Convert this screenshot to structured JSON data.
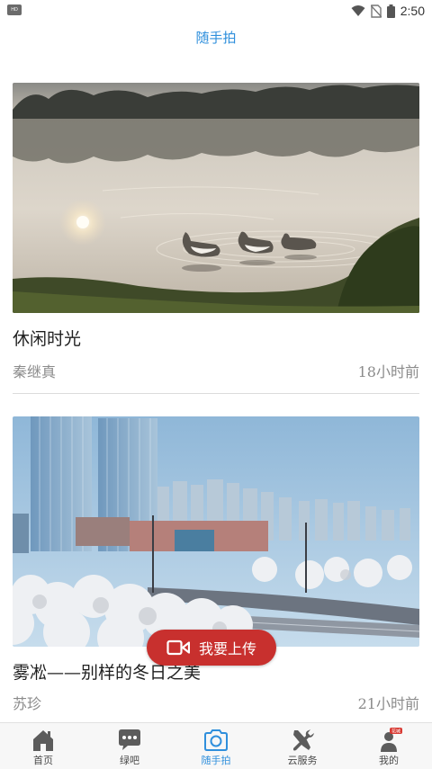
{
  "status_bar": {
    "sim_label": "HD",
    "time": "2:50"
  },
  "header": {
    "title": "随手拍"
  },
  "posts": [
    {
      "title": "休闲时光",
      "author": "秦继真",
      "time_ago": "18小时前"
    },
    {
      "title": "雾凇——别样的冬日之美",
      "author": "苏珍",
      "time_ago": "21小时前"
    }
  ],
  "upload_button": {
    "label": "我要上传"
  },
  "tabbar": {
    "items": [
      {
        "label": "首页",
        "icon": "home-icon"
      },
      {
        "label": "绿吧",
        "icon": "chat-bubble-icon"
      },
      {
        "label": "随手拍",
        "icon": "camera-icon"
      },
      {
        "label": "云服务",
        "icon": "tools-icon"
      },
      {
        "label": "我的",
        "icon": "profile-icon",
        "badge": "花城"
      }
    ],
    "active_index": 2
  },
  "colors": {
    "accent": "#2f8fdc",
    "upload": "#c8302e",
    "tab_inactive": "#5c5c5c"
  }
}
